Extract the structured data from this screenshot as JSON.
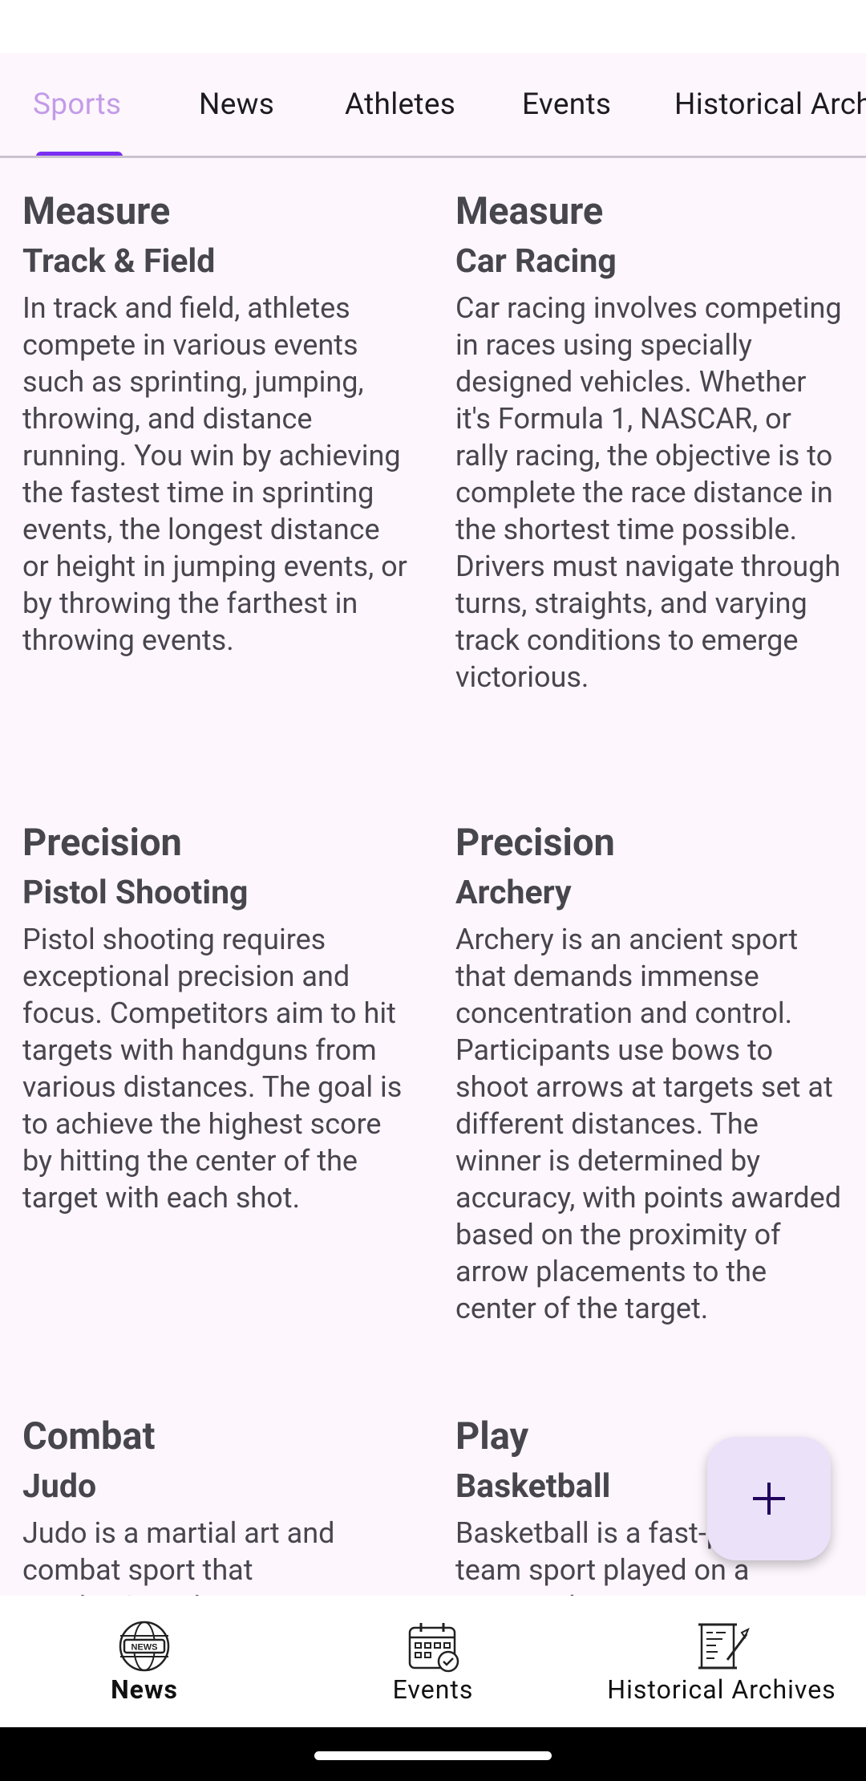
{
  "tabs": [
    {
      "label": "Sports",
      "active": true
    },
    {
      "label": "News",
      "active": false
    },
    {
      "label": "Athletes",
      "active": false
    },
    {
      "label": "Events",
      "active": false
    },
    {
      "label": "Historical Archives",
      "active": false
    }
  ],
  "cards": [
    {
      "category": "Measure",
      "name": "Track & Field",
      "description": "In track and field, athletes compete in various events such as sprinting, jumping, throwing, and distance running. You win by achieving the fastest time in sprinting events, the longest distance or height in jumping events, or by throwing the farthest in throwing events."
    },
    {
      "category": "Measure",
      "name": "Car Racing",
      "description": "Car racing involves competing in races using specially designed vehicles. Whether it's Formula 1, NASCAR, or rally racing, the objective is to complete the race distance in the shortest time possible. Drivers must navigate through turns, straights, and varying track conditions to emerge victorious."
    },
    {
      "category": "Precision",
      "name": "Pistol Shooting",
      "description": "Pistol shooting requires exceptional precision and focus. Competitors aim to hit targets with handguns from various distances. The goal is to achieve the highest score by hitting the center of the target with each shot."
    },
    {
      "category": "Precision",
      "name": "Archery",
      "description": "Archery is an ancient sport that demands immense concentration and control. Participants use bows to shoot arrows at targets set at different distances. The winner is determined by accuracy, with points awarded based on the proximity of arrow placements to the center of the target."
    },
    {
      "category": "Combat",
      "name": "Judo",
      "description": "Judo is a martial art and combat sport that emphasizes throws, grappling"
    },
    {
      "category": "Play",
      "name": "Basketball",
      "description": "Basketball is a fast-paced team sport played on a rectangular court. Two"
    }
  ],
  "fab": {
    "icon": "plus-icon"
  },
  "bottom_nav": [
    {
      "label": "News",
      "icon": "news-globe-icon",
      "selected": true
    },
    {
      "label": "Events",
      "icon": "calendar-check-icon",
      "selected": false
    },
    {
      "label": "Historical Archives",
      "icon": "scroll-quill-icon",
      "selected": false
    }
  ],
  "colors": {
    "background": "#fdf7fd",
    "tab_active": "#c39be8",
    "tab_indicator": "#7b2ff2",
    "fab_bg": "#ebe1f9",
    "fab_icon": "#21005d"
  }
}
